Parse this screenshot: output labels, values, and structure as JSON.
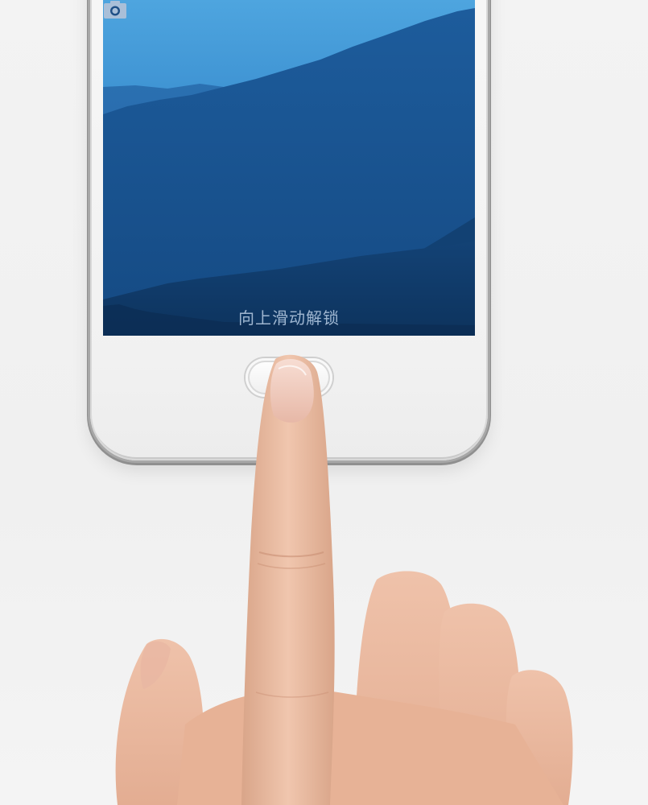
{
  "lock_screen": {
    "unlock_hint": "向上滑动解锁",
    "camera_icon": "camera-icon"
  },
  "colors": {
    "sky_top": "#4ea3dd",
    "sky_mid": "#2f7cc0",
    "mountain_dark": "#0f3460",
    "bezel": "#f4f4f4",
    "background": "#f2f2f2"
  }
}
